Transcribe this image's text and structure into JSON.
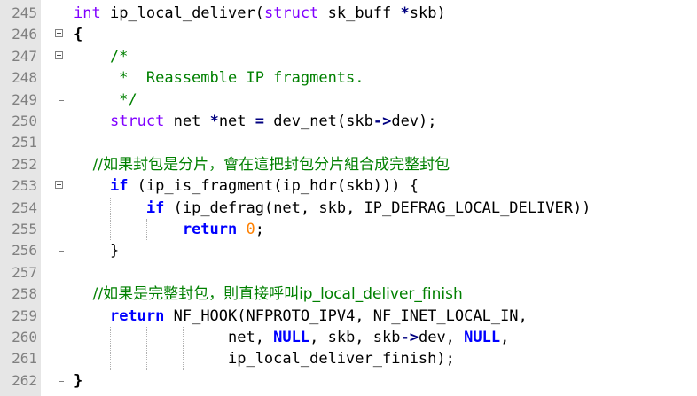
{
  "editor": {
    "colors": {
      "gutter_bg": "#e6e6e6",
      "line_number": "#808080",
      "keyword": "#0000ff",
      "type_keyword": "#8000ff",
      "comment": "#008000",
      "number": "#ff8000",
      "operator": "#000080",
      "text": "#000000"
    },
    "lines": [
      {
        "n": "245",
        "fold": "none",
        "tokens": [
          {
            "t": "int",
            "c": "type"
          },
          {
            "t": " ip_local_deliver(",
            "c": ""
          },
          {
            "t": "struct",
            "c": "type"
          },
          {
            "t": " sk_buff ",
            "c": ""
          },
          {
            "t": "*",
            "c": "op"
          },
          {
            "t": "skb)",
            "c": ""
          }
        ]
      },
      {
        "n": "246",
        "fold": "open",
        "tokens": [
          {
            "t": "{",
            "c": "bold"
          }
        ]
      },
      {
        "n": "247",
        "fold": "open-inner",
        "tokens": [
          {
            "t": "    /*",
            "c": "cmt"
          }
        ]
      },
      {
        "n": "248",
        "fold": "line",
        "tokens": [
          {
            "t": "     *  Reassemble IP fragments.",
            "c": "cmt"
          }
        ]
      },
      {
        "n": "249",
        "fold": "end-inner",
        "tokens": [
          {
            "t": "     */",
            "c": "cmt"
          }
        ]
      },
      {
        "n": "250",
        "fold": "line",
        "tokens": [
          {
            "t": "    ",
            "c": ""
          },
          {
            "t": "struct",
            "c": "type"
          },
          {
            "t": " net ",
            "c": ""
          },
          {
            "t": "*",
            "c": "op"
          },
          {
            "t": "net ",
            "c": ""
          },
          {
            "t": "=",
            "c": "op"
          },
          {
            "t": " dev_net(skb",
            "c": ""
          },
          {
            "t": "->",
            "c": "op"
          },
          {
            "t": "dev);",
            "c": ""
          }
        ]
      },
      {
        "n": "251",
        "fold": "line",
        "tokens": []
      },
      {
        "n": "252",
        "fold": "line",
        "tokens": [
          {
            "t": "    //如果封包是分片，會在這把封包分片組合成完整封包",
            "c": "cmt"
          }
        ]
      },
      {
        "n": "253",
        "fold": "open-inner",
        "tokens": [
          {
            "t": "    ",
            "c": ""
          },
          {
            "t": "if",
            "c": "kw bold"
          },
          {
            "t": " (ip_is_fragment(ip_hdr(skb))) {",
            "c": ""
          }
        ]
      },
      {
        "n": "254",
        "fold": "line",
        "tokens": [
          {
            "t": "        ",
            "c": ""
          },
          {
            "t": "if",
            "c": "kw bold"
          },
          {
            "t": " (ip_defrag(net, skb, IP_DEFRAG_LOCAL_DELIVER))",
            "c": ""
          }
        ]
      },
      {
        "n": "255",
        "fold": "line",
        "tokens": [
          {
            "t": "            ",
            "c": ""
          },
          {
            "t": "return",
            "c": "kw bold"
          },
          {
            "t": " ",
            "c": ""
          },
          {
            "t": "0",
            "c": "num"
          },
          {
            "t": ";",
            "c": ""
          }
        ]
      },
      {
        "n": "256",
        "fold": "end-inner",
        "tokens": [
          {
            "t": "    }",
            "c": ""
          }
        ]
      },
      {
        "n": "257",
        "fold": "line",
        "tokens": []
      },
      {
        "n": "258",
        "fold": "line",
        "tokens": [
          {
            "t": "    //如果是完整封包，則直接呼叫ip_local_deliver_finish",
            "c": "cmt"
          }
        ]
      },
      {
        "n": "259",
        "fold": "line",
        "tokens": [
          {
            "t": "    ",
            "c": ""
          },
          {
            "t": "return",
            "c": "kw bold"
          },
          {
            "t": " NF_HOOK(NFPROTO_IPV4, NF_INET_LOCAL_IN,",
            "c": ""
          }
        ]
      },
      {
        "n": "260",
        "fold": "line",
        "tokens": [
          {
            "t": "                 net, ",
            "c": ""
          },
          {
            "t": "NULL",
            "c": "kw bold"
          },
          {
            "t": ", skb, skb",
            "c": ""
          },
          {
            "t": "->",
            "c": "op"
          },
          {
            "t": "dev, ",
            "c": ""
          },
          {
            "t": "NULL",
            "c": "kw bold"
          },
          {
            "t": ",",
            "c": ""
          }
        ]
      },
      {
        "n": "261",
        "fold": "line",
        "tokens": [
          {
            "t": "                 ip_local_deliver_finish);",
            "c": ""
          }
        ]
      },
      {
        "n": "262",
        "fold": "end",
        "tokens": [
          {
            "t": "}",
            "c": "bold"
          }
        ]
      }
    ]
  }
}
